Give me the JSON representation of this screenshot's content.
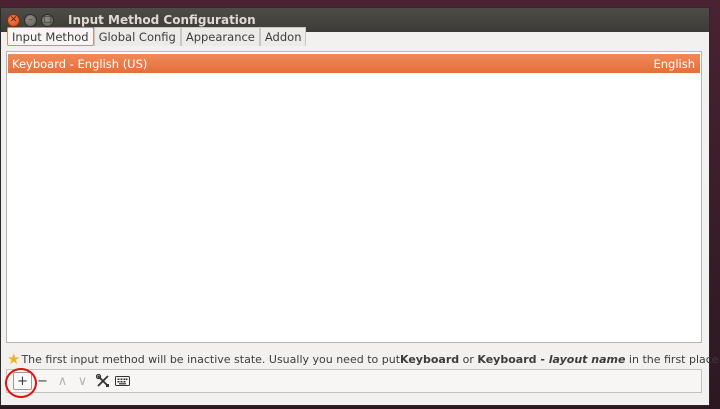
{
  "window": {
    "title": "Input Method Configuration"
  },
  "tabs": [
    {
      "label": "Input Method",
      "active": true
    },
    {
      "label": "Global Config",
      "active": false
    },
    {
      "label": "Appearance",
      "active": false
    },
    {
      "label": "Addon",
      "active": false
    }
  ],
  "input_methods": [
    {
      "name": "Keyboard - English (US)",
      "language": "English",
      "selected": true
    }
  ],
  "hint": {
    "text_1": "The first input method will be inactive state. Usually you need to put ",
    "bold_1": "Keyboard",
    "text_2": " or ",
    "bold_2": "Keyboard - ",
    "italic_bold": "layout name",
    "text_3": " in the first place."
  },
  "toolbar": {
    "add": "+",
    "remove": "−",
    "up": "∧",
    "down": "∨",
    "configure_icon": "tools-icon",
    "keyboard_icon": "keyboard-icon"
  },
  "colors": {
    "selection": "#e46f3b",
    "annotation_circle": "#e01010"
  }
}
